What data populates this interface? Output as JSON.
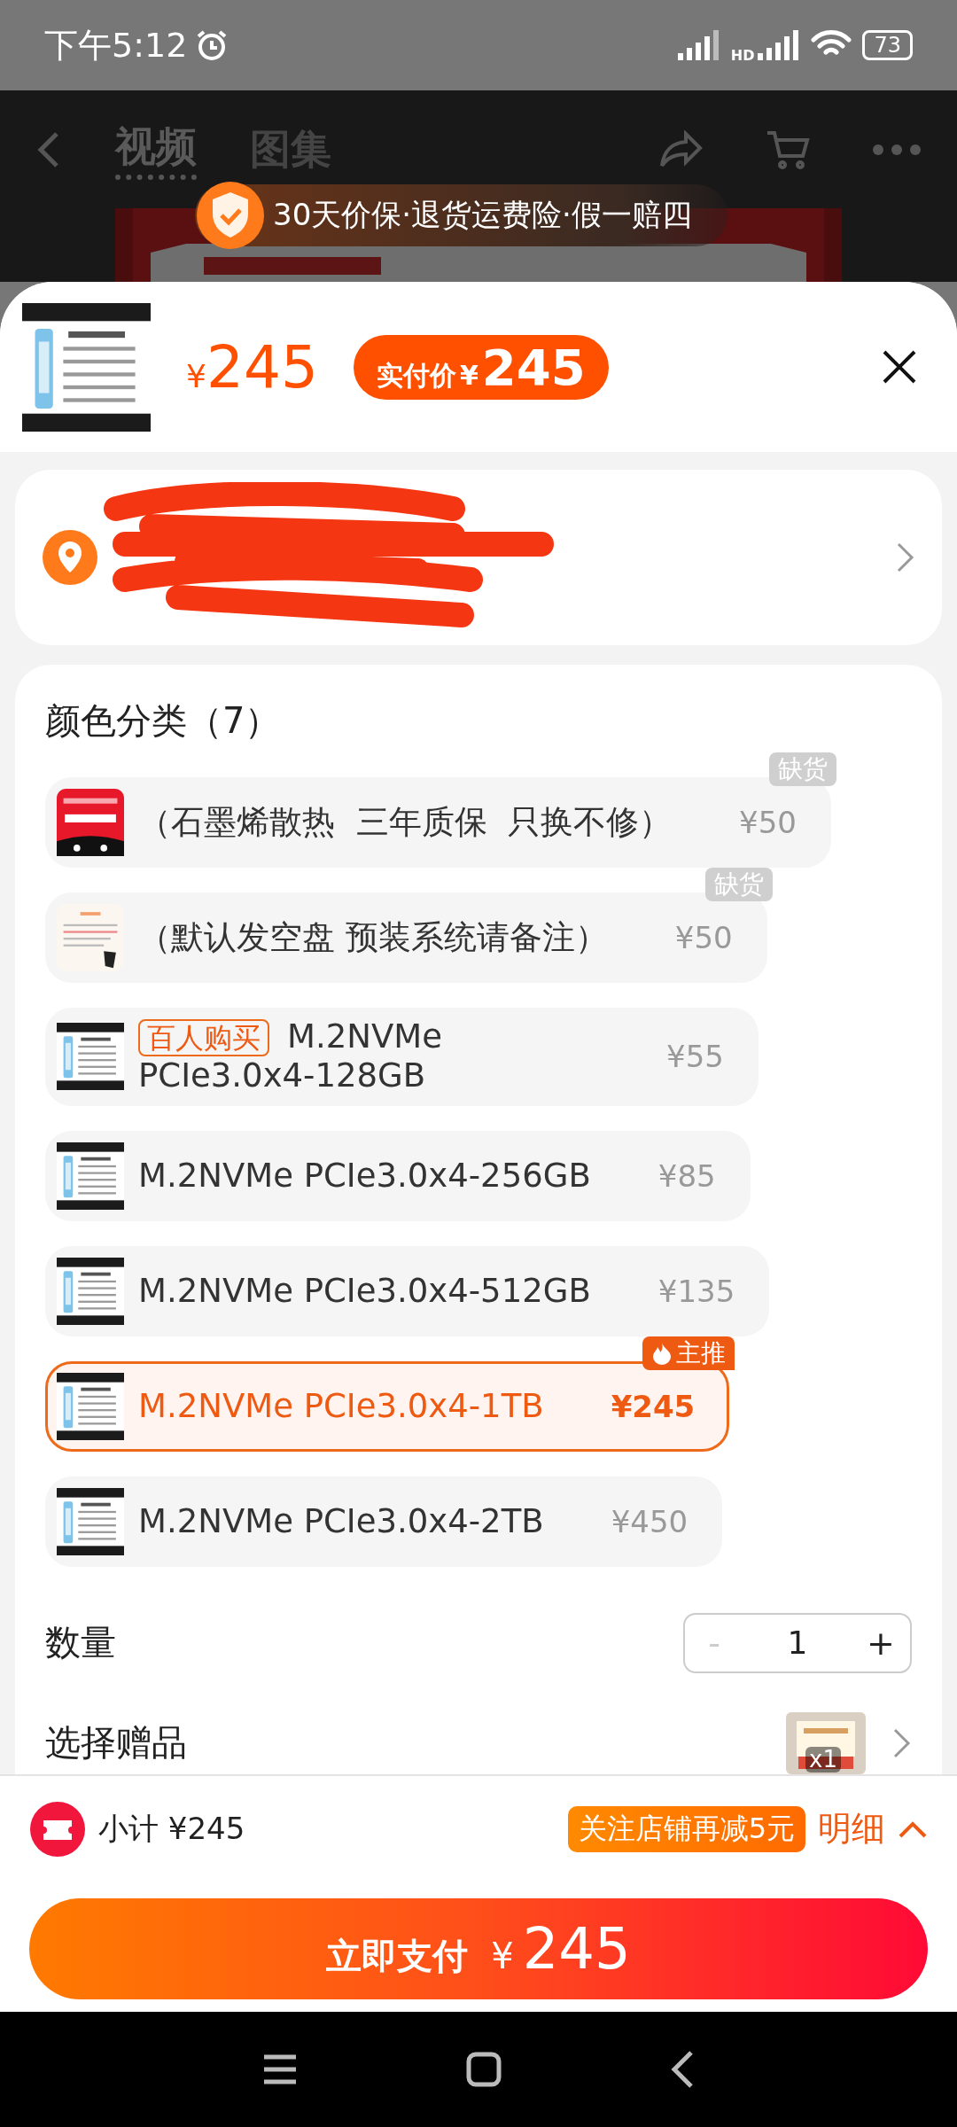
{
  "status_bar": {
    "time": "下午5:12",
    "network_label": "HD",
    "battery": "73"
  },
  "nav": {
    "tabs": [
      {
        "label": "视频",
        "selected": true
      },
      {
        "label": "图集",
        "selected": false
      }
    ]
  },
  "banner": {
    "text": "30天价保·退货运费险·假一赔四"
  },
  "header": {
    "price_symbol": "¥",
    "price": "245",
    "paid_label": "实付价",
    "paid_symbol": "¥",
    "paid_price": "245"
  },
  "options": {
    "title": "颜色分类（7）",
    "items": [
      {
        "label": "（石墨烯散热  三年质保  只换不修）",
        "price": "¥50",
        "selected": false,
        "corner_badge": {
          "kind": "stock",
          "text": "缺货"
        }
      },
      {
        "label": "（默认发空盘 预装系统请备注）",
        "price": "¥50",
        "selected": false,
        "corner_badge": {
          "kind": "stock",
          "text": "缺货"
        }
      },
      {
        "tag": "百人购买",
        "label": "M.2NVMe PCIe3.0x4-128GB",
        "price": "¥55",
        "selected": false
      },
      {
        "label": "M.2NVMe PCIe3.0x4-256GB",
        "price": "¥85",
        "selected": false
      },
      {
        "label": "M.2NVMe PCIe3.0x4-512GB",
        "price": "¥135",
        "selected": false
      },
      {
        "label": "M.2NVMe PCIe3.0x4-1TB",
        "price": "¥245",
        "selected": true,
        "corner_badge": {
          "kind": "hot",
          "text": "主推"
        }
      },
      {
        "label": "M.2NVMe PCIe3.0x4-2TB",
        "price": "¥450",
        "selected": false
      }
    ]
  },
  "quantity": {
    "label": "数量",
    "minus": "-",
    "value": "1",
    "plus": "+",
    "minus_disabled": true
  },
  "gift": {
    "label": "选择赠品",
    "count": "x1"
  },
  "footer": {
    "subtotal_label": "小计",
    "subtotal": "¥245",
    "promo": "关注店铺再减5元",
    "details": "明细",
    "pay_label": "立即支付",
    "pay_symbol": "¥",
    "pay_amount": "245"
  }
}
